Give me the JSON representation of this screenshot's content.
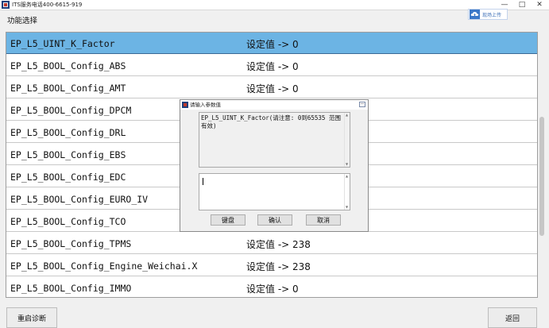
{
  "window": {
    "title": "ITS服务电话400-6615-919",
    "controls": {
      "minimize": "—",
      "maximize": "□",
      "close": "✕"
    }
  },
  "header": {
    "section_label": "功能选择",
    "upload_button_label": "现场上传"
  },
  "list": {
    "selected_index": 0,
    "rows": [
      {
        "name": "EP_L5_UINT_K_Factor",
        "value": "设定值 -> 0"
      },
      {
        "name": "EP_L5_BOOL_Config_ABS",
        "value": "设定值 -> 0"
      },
      {
        "name": "EP_L5_BOOL_Config_AMT",
        "value": "设定值 -> 0"
      },
      {
        "name": "EP_L5_BOOL_Config_DPCM",
        "value": ""
      },
      {
        "name": "EP_L5_BOOL_Config_DRL",
        "value": ""
      },
      {
        "name": "EP_L5_BOOL_Config_EBS",
        "value": ""
      },
      {
        "name": "EP_L5_BOOL_Config_EDC",
        "value": ""
      },
      {
        "name": "EP_L5_BOOL_Config_EURO_IV",
        "value": ""
      },
      {
        "name": "EP_L5_BOOL_Config_TCO",
        "value": ""
      },
      {
        "name": "EP_L5_BOOL_Config_TPMS",
        "value": "设定值 -> 238"
      },
      {
        "name": "EP_L5_BOOL_Config_Engine_Weichai.X",
        "value": "设定值 -> 238"
      },
      {
        "name": "EP_L5_BOOL_Config_IMMO",
        "value": "设定值 -> 0"
      }
    ]
  },
  "footer": {
    "restart_label": "重启诊断",
    "back_label": "返回"
  },
  "dialog": {
    "title": "请输入参数值",
    "message": "EP_L5_UINT_K_Factor(请注意: 0到65535 范围有效)",
    "input_value": "",
    "keyboard_label": "键盘",
    "ok_label": "确认",
    "cancel_label": "取消",
    "minimize": "—"
  },
  "colors": {
    "selected_row": "#6cb4e4",
    "upload_text": "#3c6fb7"
  }
}
